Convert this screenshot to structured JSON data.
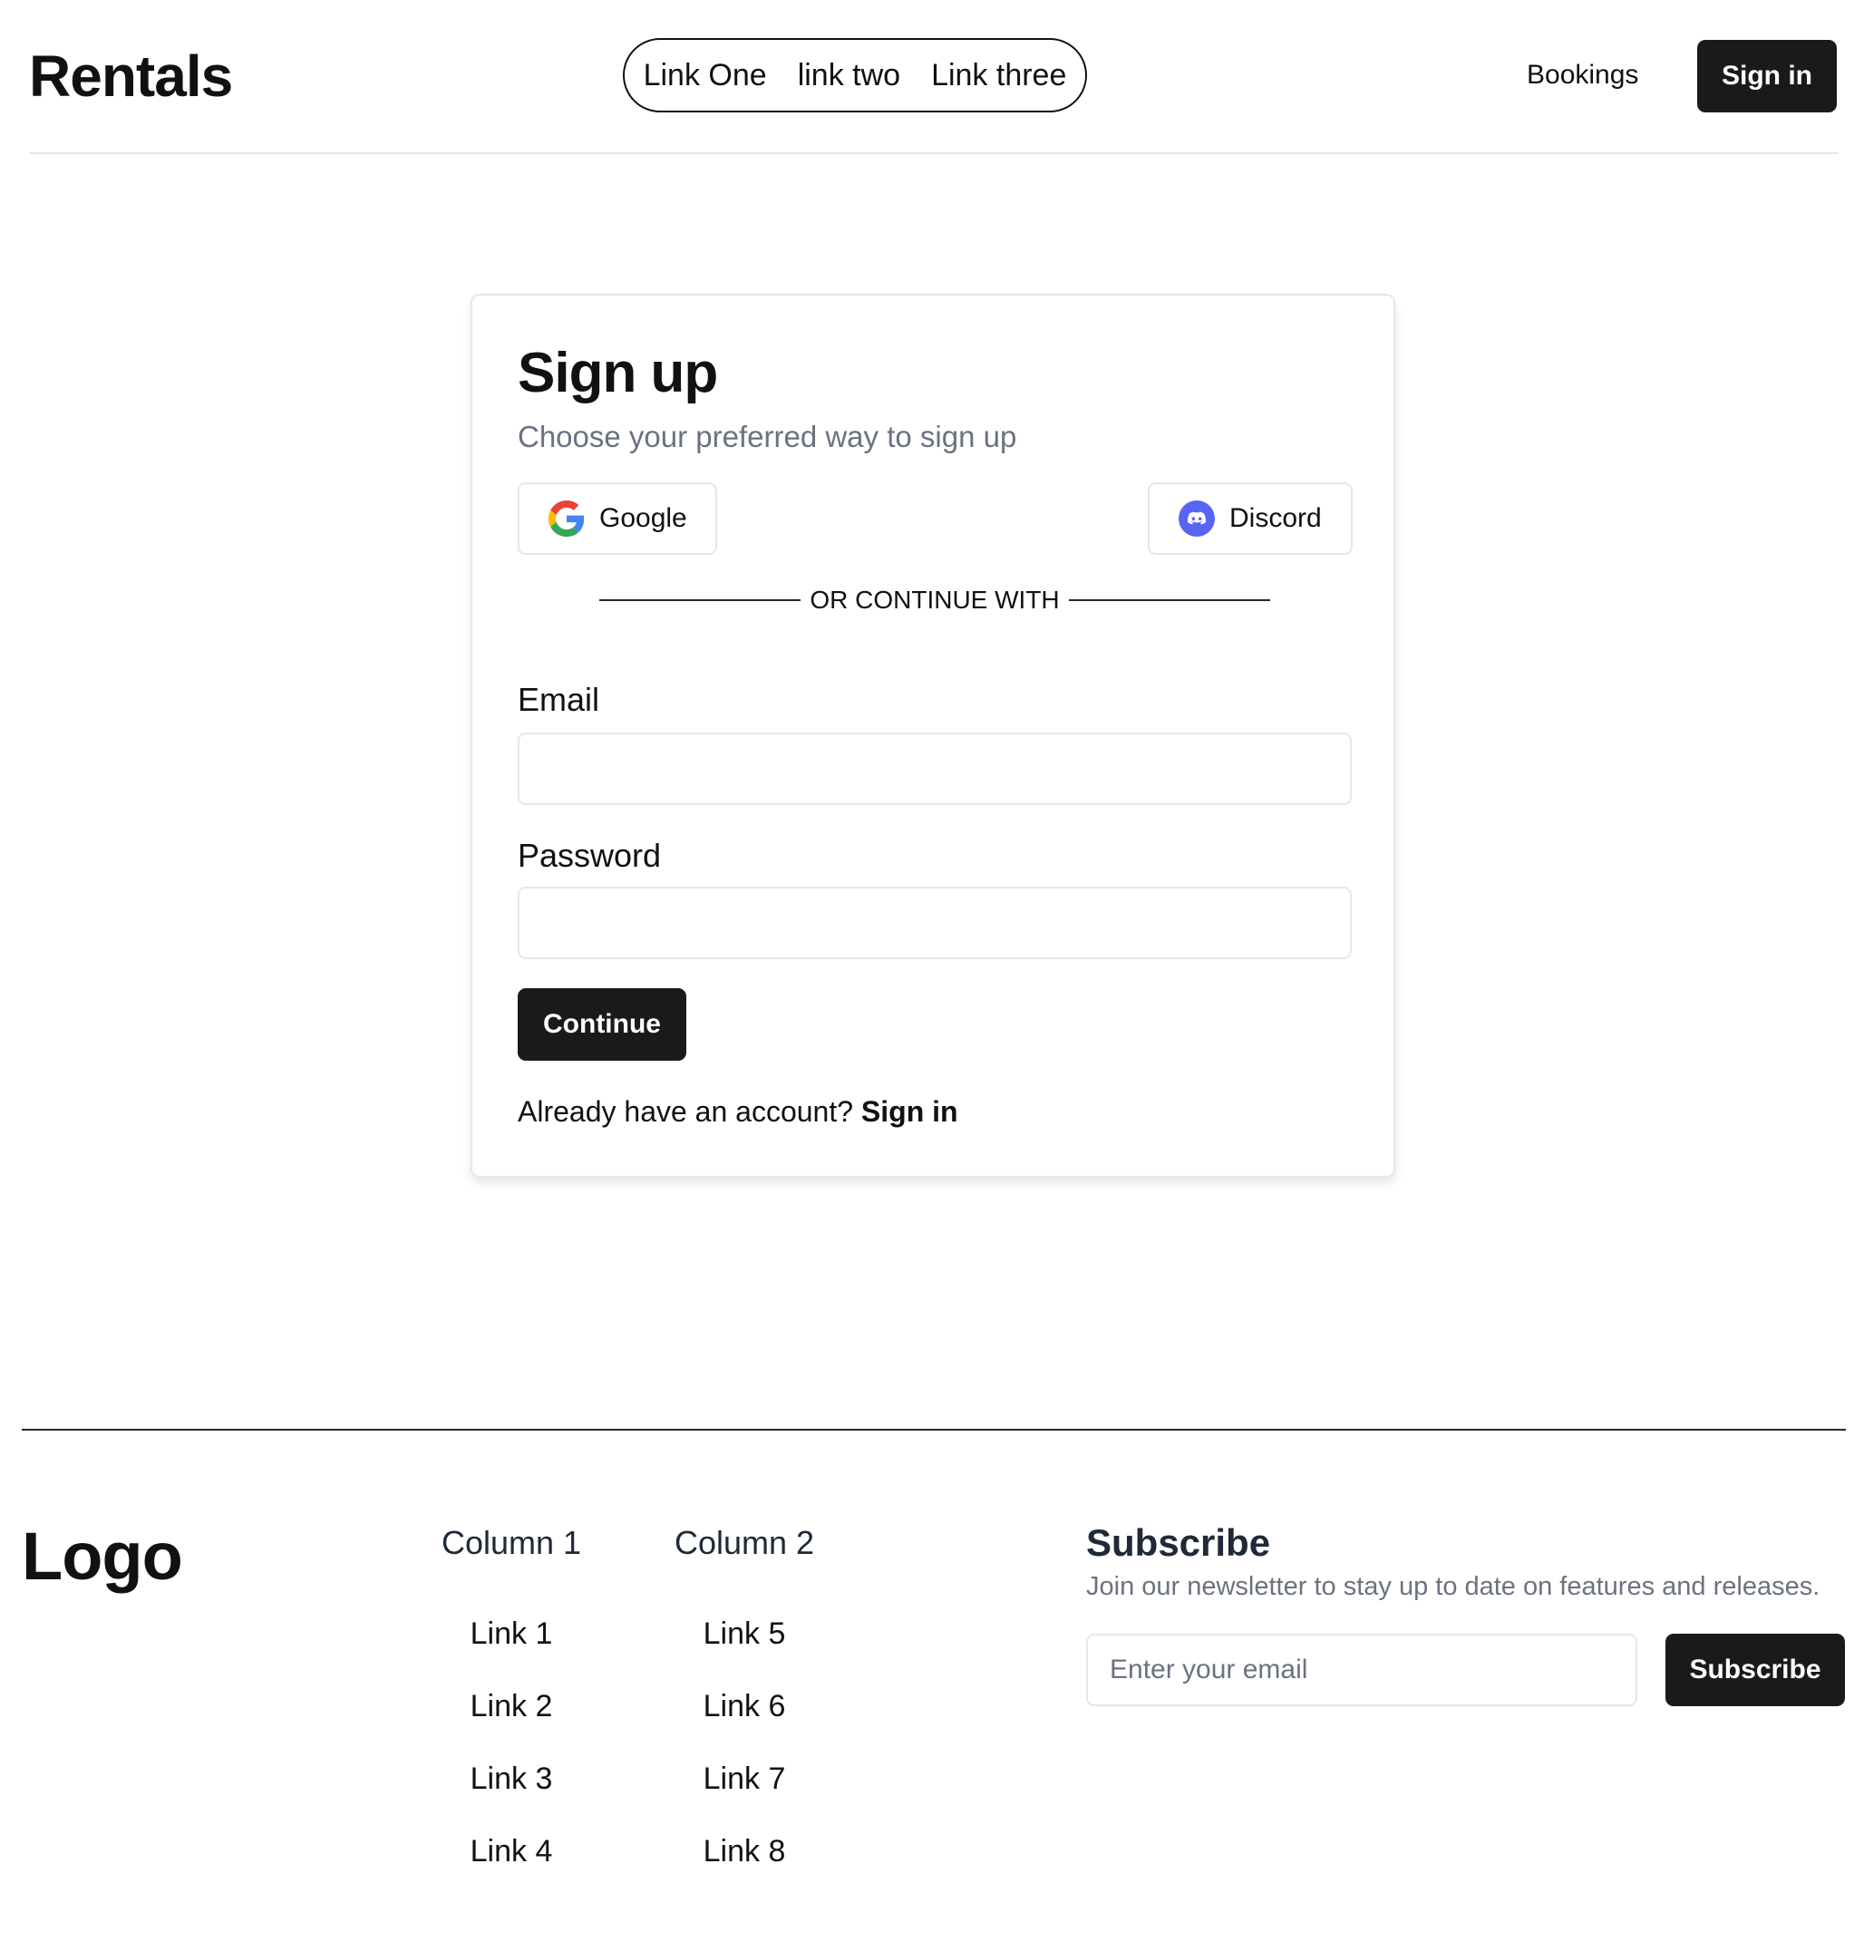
{
  "header": {
    "brand": "Rentals",
    "nav_links": [
      "Link One",
      "link two",
      "Link three"
    ],
    "bookings": "Bookings",
    "sign_in": "Sign in"
  },
  "signup": {
    "title": "Sign up",
    "subtitle": "Choose your preferred way to sign up",
    "google_label": "Google",
    "discord_label": "Discord",
    "divider": "OR CONTINUE WITH",
    "email_label": "Email",
    "email_value": "",
    "password_label": "Password",
    "password_value": "",
    "continue_label": "Continue",
    "already_text": "Already have an account?",
    "already_link": "Sign in"
  },
  "footer": {
    "logo": "Logo",
    "columns": [
      {
        "title": "Column 1",
        "links": [
          "Link 1",
          "Link 2",
          "Link 3",
          "Link 4"
        ]
      },
      {
        "title": "Column 2",
        "links": [
          "Link 5",
          "Link 6",
          "Link 7",
          "Link 8"
        ]
      }
    ],
    "subscribe": {
      "title": "Subscribe",
      "description": "Join our newsletter to stay up to date on features and releases.",
      "placeholder": "Enter your email",
      "button": "Subscribe"
    }
  },
  "colors": {
    "primary_button": "#1a1a1a",
    "muted_text": "#6b7280",
    "border": "#e5e7eb",
    "discord_brand": "#5865f2"
  }
}
